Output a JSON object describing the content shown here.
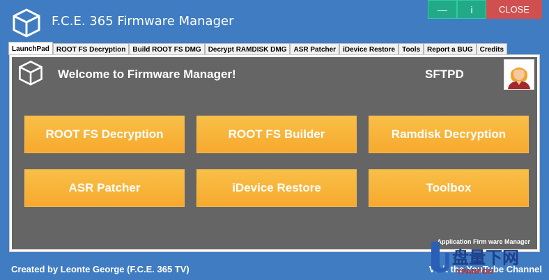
{
  "window": {
    "title": "F.C.E. 365 Firmware Manager",
    "minimize_label": "—",
    "info_label": "i",
    "close_label": "CLOSE"
  },
  "tabs": [
    {
      "label": "LaunchPad",
      "active": true
    },
    {
      "label": "ROOT FS Decryption"
    },
    {
      "label": "Build ROOT FS DMG"
    },
    {
      "label": "Decrypt RAMDISK DMG"
    },
    {
      "label": "ASR Patcher"
    },
    {
      "label": "iDevice Restore"
    },
    {
      "label": "Tools"
    },
    {
      "label": "Report a BUG"
    },
    {
      "label": "Credits"
    }
  ],
  "launchpad": {
    "welcome": "Welcome to Firmware Manager!",
    "user": "SFTPD",
    "buttons": [
      {
        "label": "ROOT FS Decryption"
      },
      {
        "label": "ROOT FS Builder"
      },
      {
        "label": "Ramdisk Decryption"
      },
      {
        "label": "ASR Patcher"
      },
      {
        "label": "iDevice Restore"
      },
      {
        "label": "Toolbox"
      }
    ],
    "footnote": "Application Firm ware Manager"
  },
  "footer": {
    "credit": "Created by Leonte George (F.C.E. 365 TV)",
    "visit": "Visit the YouTube Channel"
  },
  "watermark": {
    "text": "盘量下网",
    "sub": "YPANFOU"
  },
  "colors": {
    "background": "#3f7cc2",
    "panel": "#656565",
    "button": "#f7b23a",
    "close": "#d05050",
    "window_btn": "#22aa88"
  }
}
